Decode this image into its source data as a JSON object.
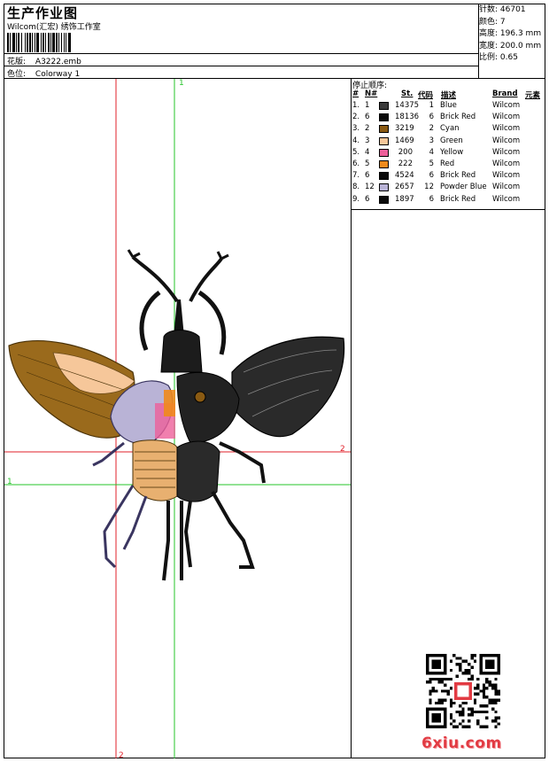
{
  "header": {
    "title": "生产作业图",
    "company": "Wilcom(汇宏) 绣饰工作室",
    "design_label": "花版:",
    "design_value": "A3222.emb",
    "color_label": "色位:",
    "color_value": "Colorway 1"
  },
  "stats": [
    {
      "label": "针数:",
      "value": "46701"
    },
    {
      "label": "颜色:",
      "value": "7"
    },
    {
      "label": "高度:",
      "value": "196.3 mm"
    },
    {
      "label": "宽度:",
      "value": "200.0 mm"
    },
    {
      "label": "比例:",
      "value": "0.65"
    }
  ],
  "stop_sequence": {
    "title": "停止顺序:",
    "headers": {
      "num": "#",
      "n": "N#",
      "st": "St.",
      "code": "代码",
      "desc": "描述",
      "brand": "Brand",
      "element": "元素"
    },
    "rows": [
      {
        "num": "1.",
        "n": "1",
        "color": "#3b3b3b",
        "st": "14375",
        "code": "1",
        "desc": "Blue",
        "brand": "Wilcom"
      },
      {
        "num": "2.",
        "n": "6",
        "color": "#0a0a0a",
        "st": "18136",
        "code": "6",
        "desc": "Brick Red",
        "brand": "Wilcom"
      },
      {
        "num": "3.",
        "n": "2",
        "color": "#8a5a12",
        "st": "3219",
        "code": "2",
        "desc": "Cyan",
        "brand": "Wilcom"
      },
      {
        "num": "4.",
        "n": "3",
        "color": "#f6c79a",
        "st": "1469",
        "code": "3",
        "desc": "Green",
        "brand": "Wilcom"
      },
      {
        "num": "5.",
        "n": "4",
        "color": "#ee5f9a",
        "st": "200",
        "code": "4",
        "desc": "Yellow",
        "brand": "Wilcom"
      },
      {
        "num": "6.",
        "n": "5",
        "color": "#f08a1c",
        "st": "222",
        "code": "5",
        "desc": "Red",
        "brand": "Wilcom"
      },
      {
        "num": "7.",
        "n": "6",
        "color": "#0a0a0a",
        "st": "4524",
        "code": "6",
        "desc": "Brick Red",
        "brand": "Wilcom"
      },
      {
        "num": "8.",
        "n": "12",
        "color": "#b9b3d6",
        "st": "2657",
        "code": "12",
        "desc": "Powder Blue",
        "brand": "Wilcom"
      },
      {
        "num": "9.",
        "n": "6",
        "color": "#0a0a0a",
        "st": "1897",
        "code": "6",
        "desc": "Brick Red",
        "brand": "Wilcom"
      }
    ]
  },
  "guides": {
    "green_top_label": "1",
    "green_left_label": "1",
    "red_right_label": "2",
    "red_bottom_label": "2"
  },
  "watermark": "6xiu.com",
  "colors": {
    "guide_red": "#e0202a",
    "guide_green": "#25c42a",
    "watermark": "#e23b43"
  }
}
